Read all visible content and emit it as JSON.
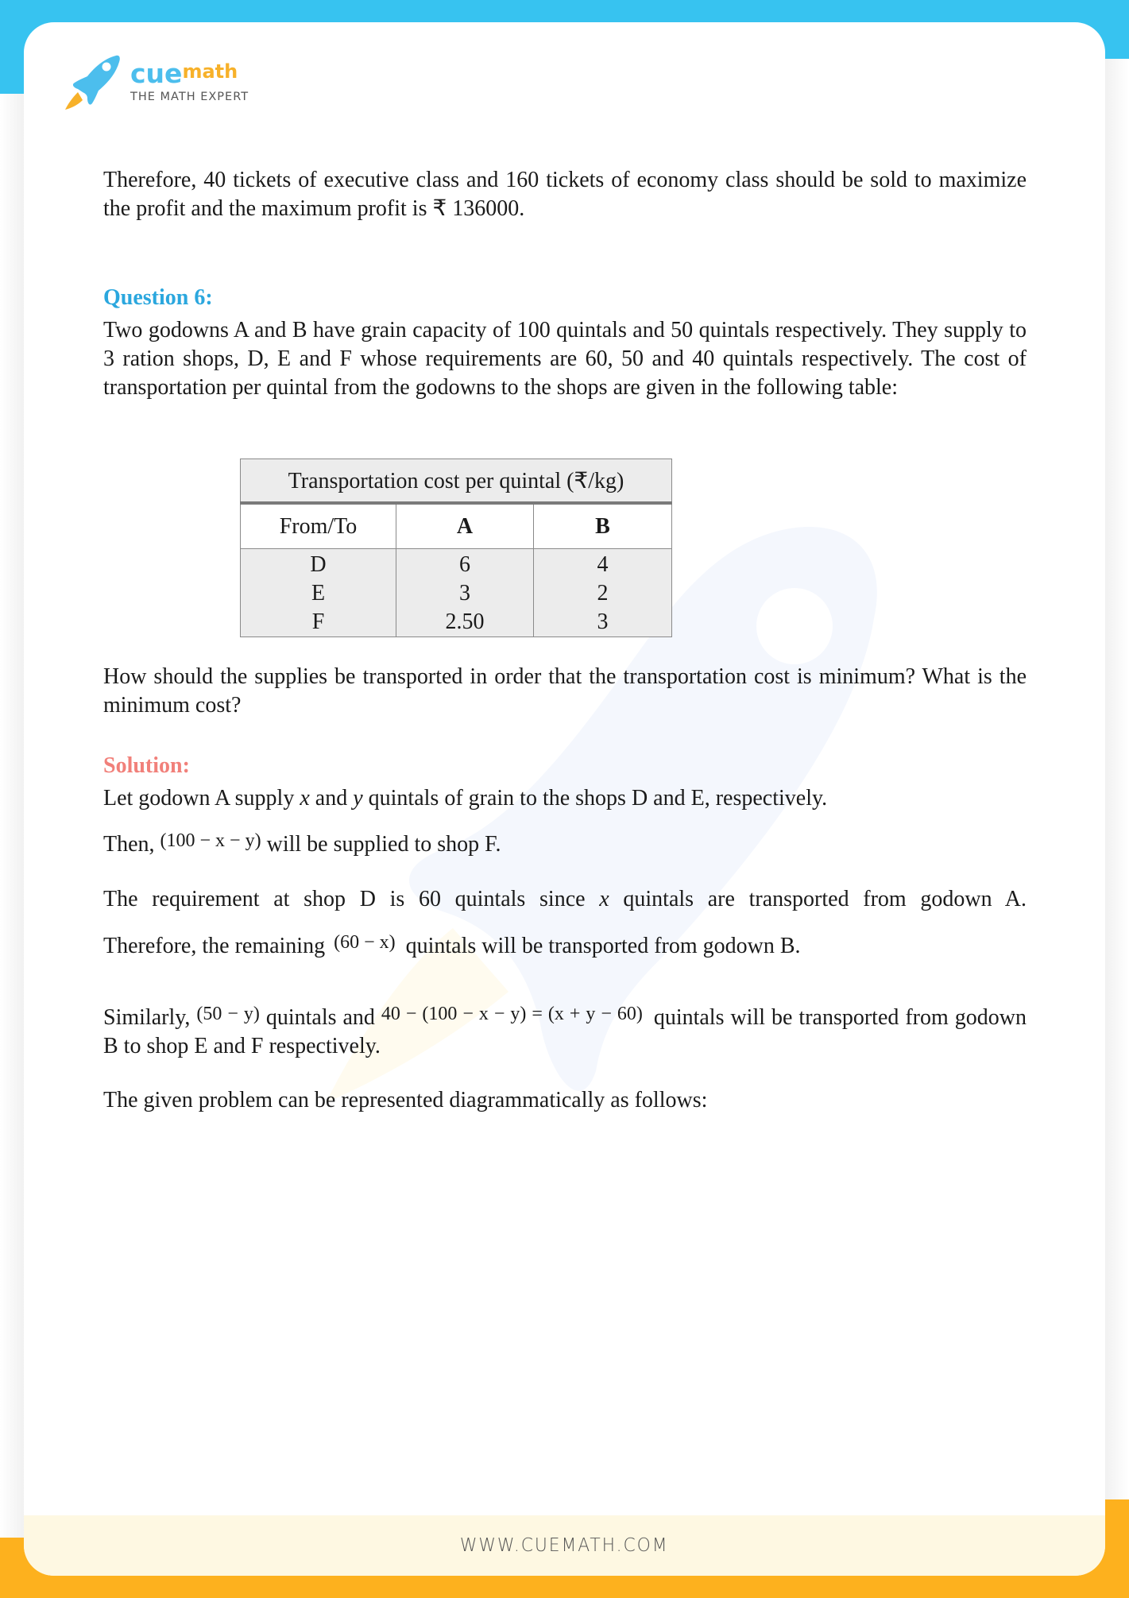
{
  "brand": {
    "name_part1": "cue",
    "name_part2": "math",
    "tagline": "THE MATH EXPERT",
    "icon": "rocket-icon",
    "colors": {
      "blue": "#37c3f0",
      "orange": "#fdb11e",
      "question_heading": "#2ba7de",
      "solution_heading": "#f1807a"
    }
  },
  "document": {
    "intro_paragraph": "Therefore, 40 tickets of executive class and 160 tickets of economy class should be sold to maximize the profit and the maximum profit is ₹ 136000.",
    "question_heading": "Question 6:",
    "question_text": "Two godowns A and B have grain capacity of 100 quintals and 50 quintals respectively. They supply to 3 ration shops, D, E and F whose requirements are 60, 50 and 40 quintals respectively. The cost of transportation per quintal from the godowns to the shops are given in the following table:",
    "table": {
      "title": "Transportation cost per quintal (₹/kg)",
      "headers": [
        "From/To",
        "A",
        "B"
      ],
      "rows": [
        [
          "D",
          "6",
          "4"
        ],
        [
          "E",
          "3",
          "2"
        ],
        [
          "F",
          "2.50",
          "3"
        ]
      ]
    },
    "question_prompt": "How should the supplies be transported in order that the transportation cost is minimum? What is the minimum cost?",
    "solution_heading": "Solution:",
    "solution": {
      "line1_a": "Let godown A supply ",
      "line1_x": "x",
      "line1_b": " and ",
      "line1_y": "y",
      "line1_c": " quintals of grain to the shops D and E, respectively.",
      "line2_a": "Then, ",
      "line2_expr": "(100 − x − y)",
      "line2_b": " will be supplied to shop F.",
      "para2_line1_a": "The requirement at shop D is 60 quintals since ",
      "para2_line1_x": "x",
      "para2_line1_b": " quintals are transported from godown A.",
      "para2_line2_a": "Therefore, the remaining ",
      "para2_line2_expr": "(60 − x)",
      "para2_line2_b": " quintals will be transported from godown B.",
      "para3_a": "Similarly, ",
      "para3_expr1": "(50 − y)",
      "para3_b": " quintals and ",
      "para3_expr2": "40 − (100 − x − y) = (x + y − 60)",
      "para3_c": " quintals will be transported from godown B to shop E and F respectively.",
      "para4": "The given problem can be represented diagrammatically as follows:"
    }
  },
  "footer": {
    "url": "WWW.CUEMATH.COM"
  }
}
